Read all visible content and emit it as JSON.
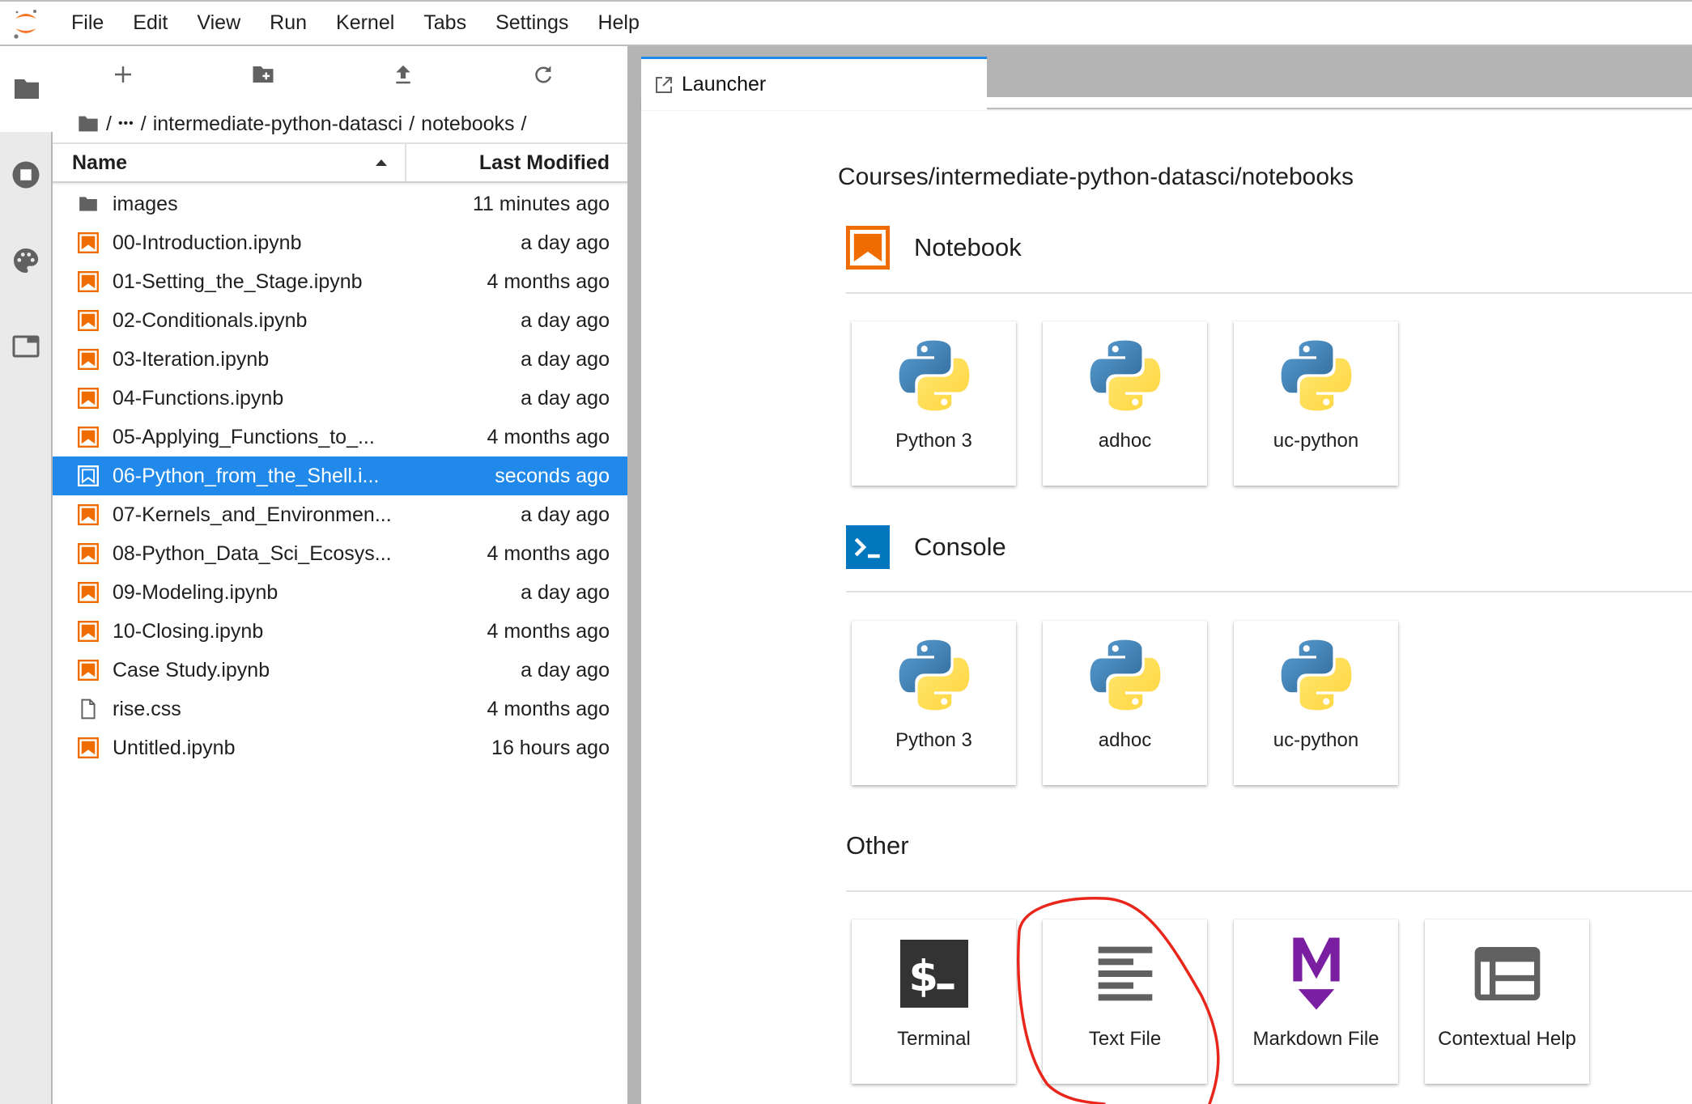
{
  "menubar": {
    "logo": "jupyter-logo",
    "items": [
      "File",
      "Edit",
      "View",
      "Run",
      "Kernel",
      "Tabs",
      "Settings",
      "Help"
    ]
  },
  "rail": {
    "tabs": [
      {
        "icon": "folder-icon",
        "active": true
      },
      {
        "icon": "running-stop-icon",
        "active": false
      },
      {
        "icon": "palette-icon",
        "active": false
      },
      {
        "icon": "tabs-icon",
        "active": false
      }
    ]
  },
  "filebrowser": {
    "toolbar": [
      "new-launcher",
      "new-folder",
      "upload",
      "refresh"
    ],
    "breadcrumb": {
      "root": "/",
      "ellipsis": "•••",
      "sep1": "/",
      "dir1": "intermediate-python-datasci",
      "sep2": "/",
      "dir2": "notebooks",
      "sep3": "/"
    },
    "columns": {
      "name": "Name",
      "modified": "Last Modified"
    },
    "sort": "ascending",
    "files": [
      {
        "name": "images",
        "modified": "11 minutes ago",
        "type": "folder",
        "selected": false
      },
      {
        "name": "00-Introduction.ipynb",
        "modified": "a day ago",
        "type": "notebook",
        "selected": false
      },
      {
        "name": "01-Setting_the_Stage.ipynb",
        "modified": "4 months ago",
        "type": "notebook",
        "selected": false
      },
      {
        "name": "02-Conditionals.ipynb",
        "modified": "a day ago",
        "type": "notebook",
        "selected": false
      },
      {
        "name": "03-Iteration.ipynb",
        "modified": "a day ago",
        "type": "notebook",
        "selected": false
      },
      {
        "name": "04-Functions.ipynb",
        "modified": "a day ago",
        "type": "notebook",
        "selected": false
      },
      {
        "name": "05-Applying_Functions_to_...",
        "modified": "4 months ago",
        "type": "notebook",
        "selected": false
      },
      {
        "name": "06-Python_from_the_Shell.i...",
        "modified": "seconds ago",
        "type": "notebook",
        "selected": true
      },
      {
        "name": "07-Kernels_and_Environmen...",
        "modified": "a day ago",
        "type": "notebook",
        "selected": false
      },
      {
        "name": "08-Python_Data_Sci_Ecosys...",
        "modified": "4 months ago",
        "type": "notebook",
        "selected": false
      },
      {
        "name": "09-Modeling.ipynb",
        "modified": "a day ago",
        "type": "notebook",
        "selected": false
      },
      {
        "name": "10-Closing.ipynb",
        "modified": "4 months ago",
        "type": "notebook",
        "selected": false
      },
      {
        "name": "Case Study.ipynb",
        "modified": "a day ago",
        "type": "notebook",
        "selected": false
      },
      {
        "name": "rise.css",
        "modified": "4 months ago",
        "type": "file",
        "selected": false
      },
      {
        "name": "Untitled.ipynb",
        "modified": "16 hours ago",
        "type": "notebook",
        "selected": false
      }
    ]
  },
  "tabs": [
    {
      "label": "Launcher",
      "icon": "launcher-icon",
      "active": true
    }
  ],
  "launcher": {
    "cwd": "Courses/intermediate-python-datasci/notebooks",
    "sections": [
      {
        "title": "Notebook",
        "icon": "notebook-icon",
        "items": [
          {
            "label": "Python 3",
            "icon": "python-logo"
          },
          {
            "label": "adhoc",
            "icon": "python-logo"
          },
          {
            "label": "uc-python",
            "icon": "python-logo"
          }
        ]
      },
      {
        "title": "Console",
        "icon": "console-icon",
        "items": [
          {
            "label": "Python 3",
            "icon": "python-logo"
          },
          {
            "label": "adhoc",
            "icon": "python-logo"
          },
          {
            "label": "uc-python",
            "icon": "python-logo"
          }
        ]
      },
      {
        "title": "Other",
        "icon": "",
        "items": [
          {
            "label": "Terminal",
            "icon": "terminal-icon"
          },
          {
            "label": "Text File",
            "icon": "text-file-icon"
          },
          {
            "label": "Markdown File",
            "icon": "markdown-icon"
          },
          {
            "label": "Contextual Help",
            "icon": "contextual-help-icon"
          }
        ]
      }
    ]
  },
  "colors": {
    "accent": "#2189ea",
    "notebook_orange": "#ef6c00",
    "console_blue": "#0277bd",
    "markdown_purple": "#7b1fa2",
    "icon_gray": "#616161",
    "annotation_red": "#e8261c"
  },
  "annotation": {
    "type": "hand-drawn-circle",
    "target": "Text File"
  }
}
